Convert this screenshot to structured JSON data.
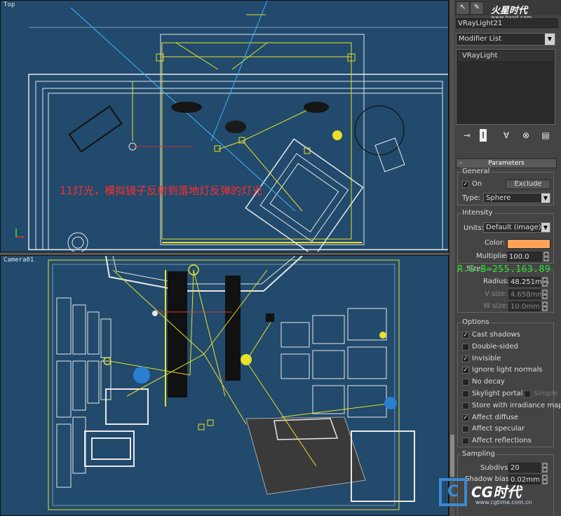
{
  "viewports": {
    "top_label": "Top",
    "camera_label": "Camera01"
  },
  "annotation_text": "11灯光，模拟镜子反射到落地灯反弹的灯光",
  "rgb_readout": "R.G.B=255.163.89",
  "panel": {
    "tabs": [
      "↖",
      "✎"
    ],
    "logo_main": "火星时代",
    "logo_url": "www.hxsd.com",
    "object_name": "VRayLight21",
    "modifier_list": "Modifier List",
    "stack_item": "VRayLight",
    "stack_buttons": [
      "⊸",
      "I",
      "∀",
      "⊗",
      "▤"
    ],
    "rollout_title": "Parameters",
    "general": {
      "title": "General",
      "on_label": "On",
      "on_checked": true,
      "exclude_label": "Exclude",
      "type_label": "Type:",
      "type_value": "Sphere"
    },
    "intensity": {
      "title": "Intensity",
      "units_label": "Units:",
      "units_value": "Default (image)",
      "color_label": "Color:",
      "color_hex": "#ffa359",
      "multiplier_label": "Multiplier:",
      "multiplier_value": "100.0"
    },
    "size": {
      "title": "Size",
      "radius_label": "Radius:",
      "radius_value": "48.251mm",
      "vsize_label": "V size:",
      "vsize_value": "4.658mm",
      "wsize_label": "W size:",
      "wsize_value": "10.0mm"
    },
    "options": {
      "title": "Options",
      "items": [
        {
          "label": "Cast shadows",
          "checked": true
        },
        {
          "label": "Double-sided",
          "checked": false
        },
        {
          "label": "Invisible",
          "checked": true
        },
        {
          "label": "Ignore light normals",
          "checked": true
        },
        {
          "label": "No decay",
          "checked": false
        },
        {
          "label": "Skylight portal",
          "checked": false
        },
        {
          "label": "Store with irradiance map",
          "checked": false
        },
        {
          "label": "Affect diffuse",
          "checked": true
        },
        {
          "label": "Affect specular",
          "checked": false
        },
        {
          "label": "Affect reflections",
          "checked": false
        }
      ],
      "simple_label": "Simple"
    },
    "sampling": {
      "title": "Sampling",
      "subdivs_label": "Subdivs:",
      "subdivs_value": "20",
      "shadowbias_label": "Shadow bias:",
      "shadowbias_value": "0.02mm"
    }
  },
  "watermark": {
    "text": "CG时代",
    "url": "www.cgtime.com.cn"
  },
  "colors": {
    "viewport_bg": "#214a6c",
    "wire_yellow": "#e8e02a",
    "wire_white": "#e8e8e8",
    "annotation_red": "#ff2e2e",
    "readout_green": "#29e62c"
  }
}
